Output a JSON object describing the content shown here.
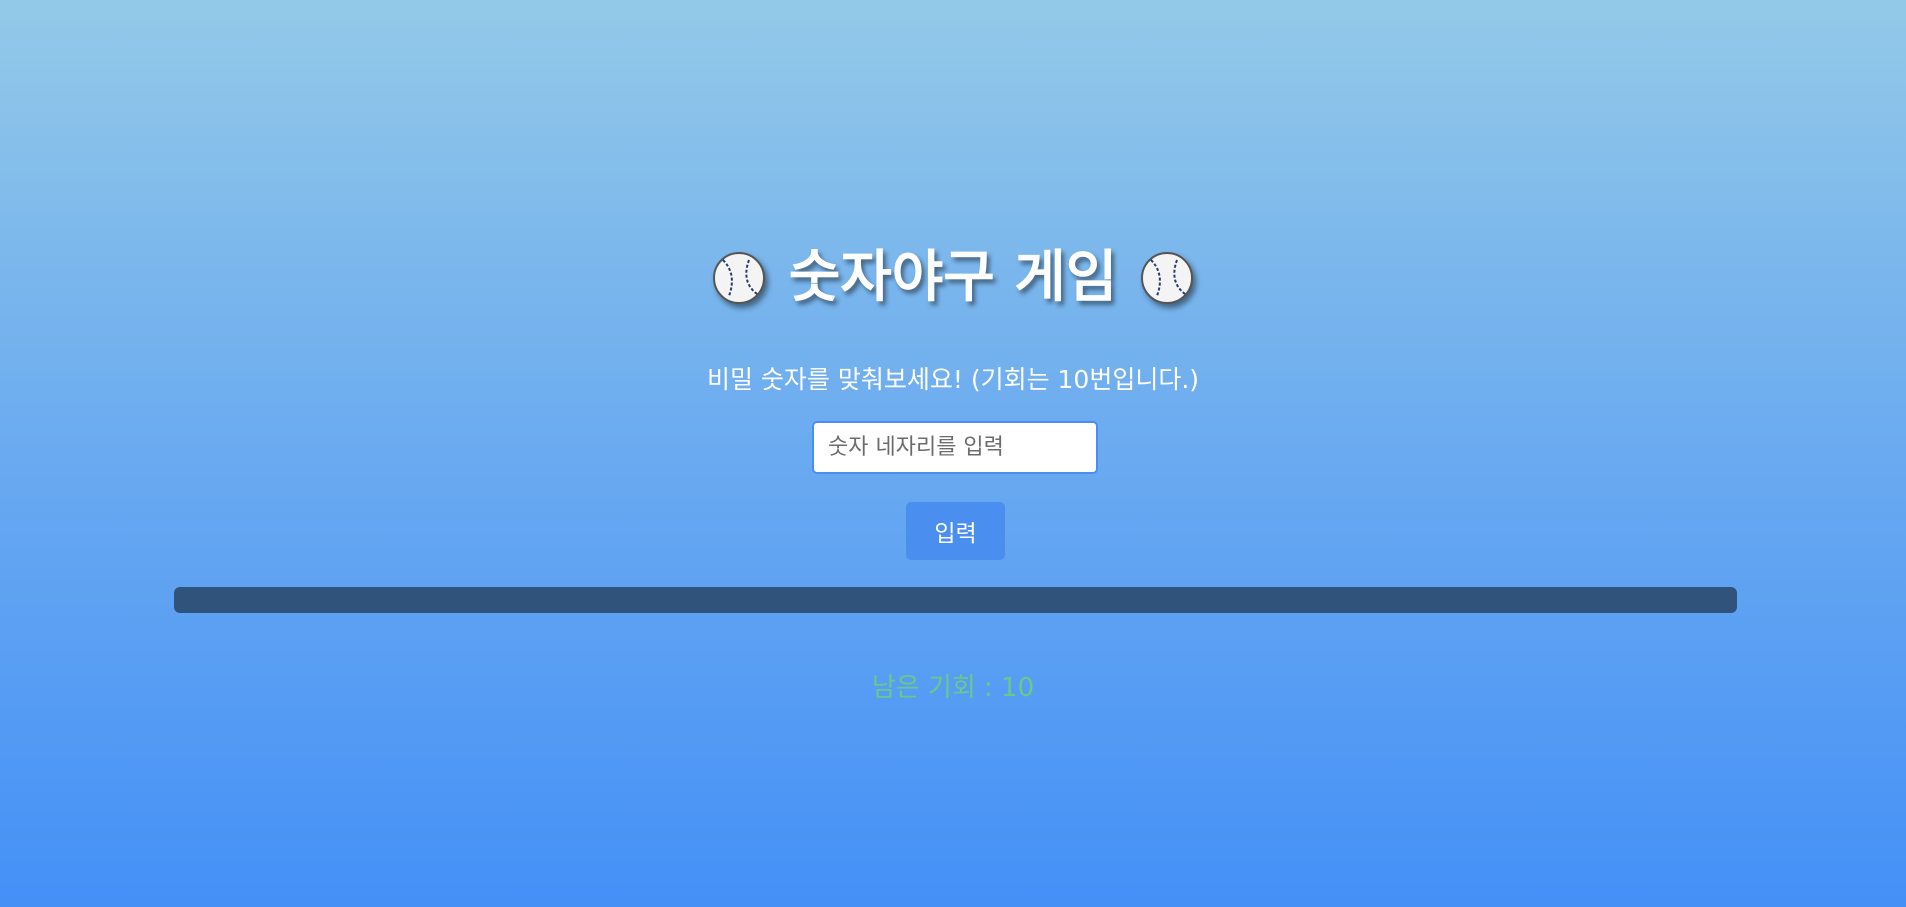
{
  "title": "숫자야구 게임",
  "icons": {
    "left": "baseball-icon",
    "right": "baseball-icon"
  },
  "subtitle": "비밀 숫자를 맞춰보세요! (기회는 10번입니다.)",
  "input": {
    "value": "",
    "placeholder": "숫자 네자리를 입력"
  },
  "submit_label": "입력",
  "result_text": "",
  "remaining": {
    "label": "남은 기회 : 10",
    "count": 10
  },
  "colors": {
    "background_top": "#93c9e8",
    "background_bottom": "#4490f7",
    "button": "#4a8ef0",
    "result_bar": "#30537c",
    "remaining_text": "#69c98b"
  }
}
